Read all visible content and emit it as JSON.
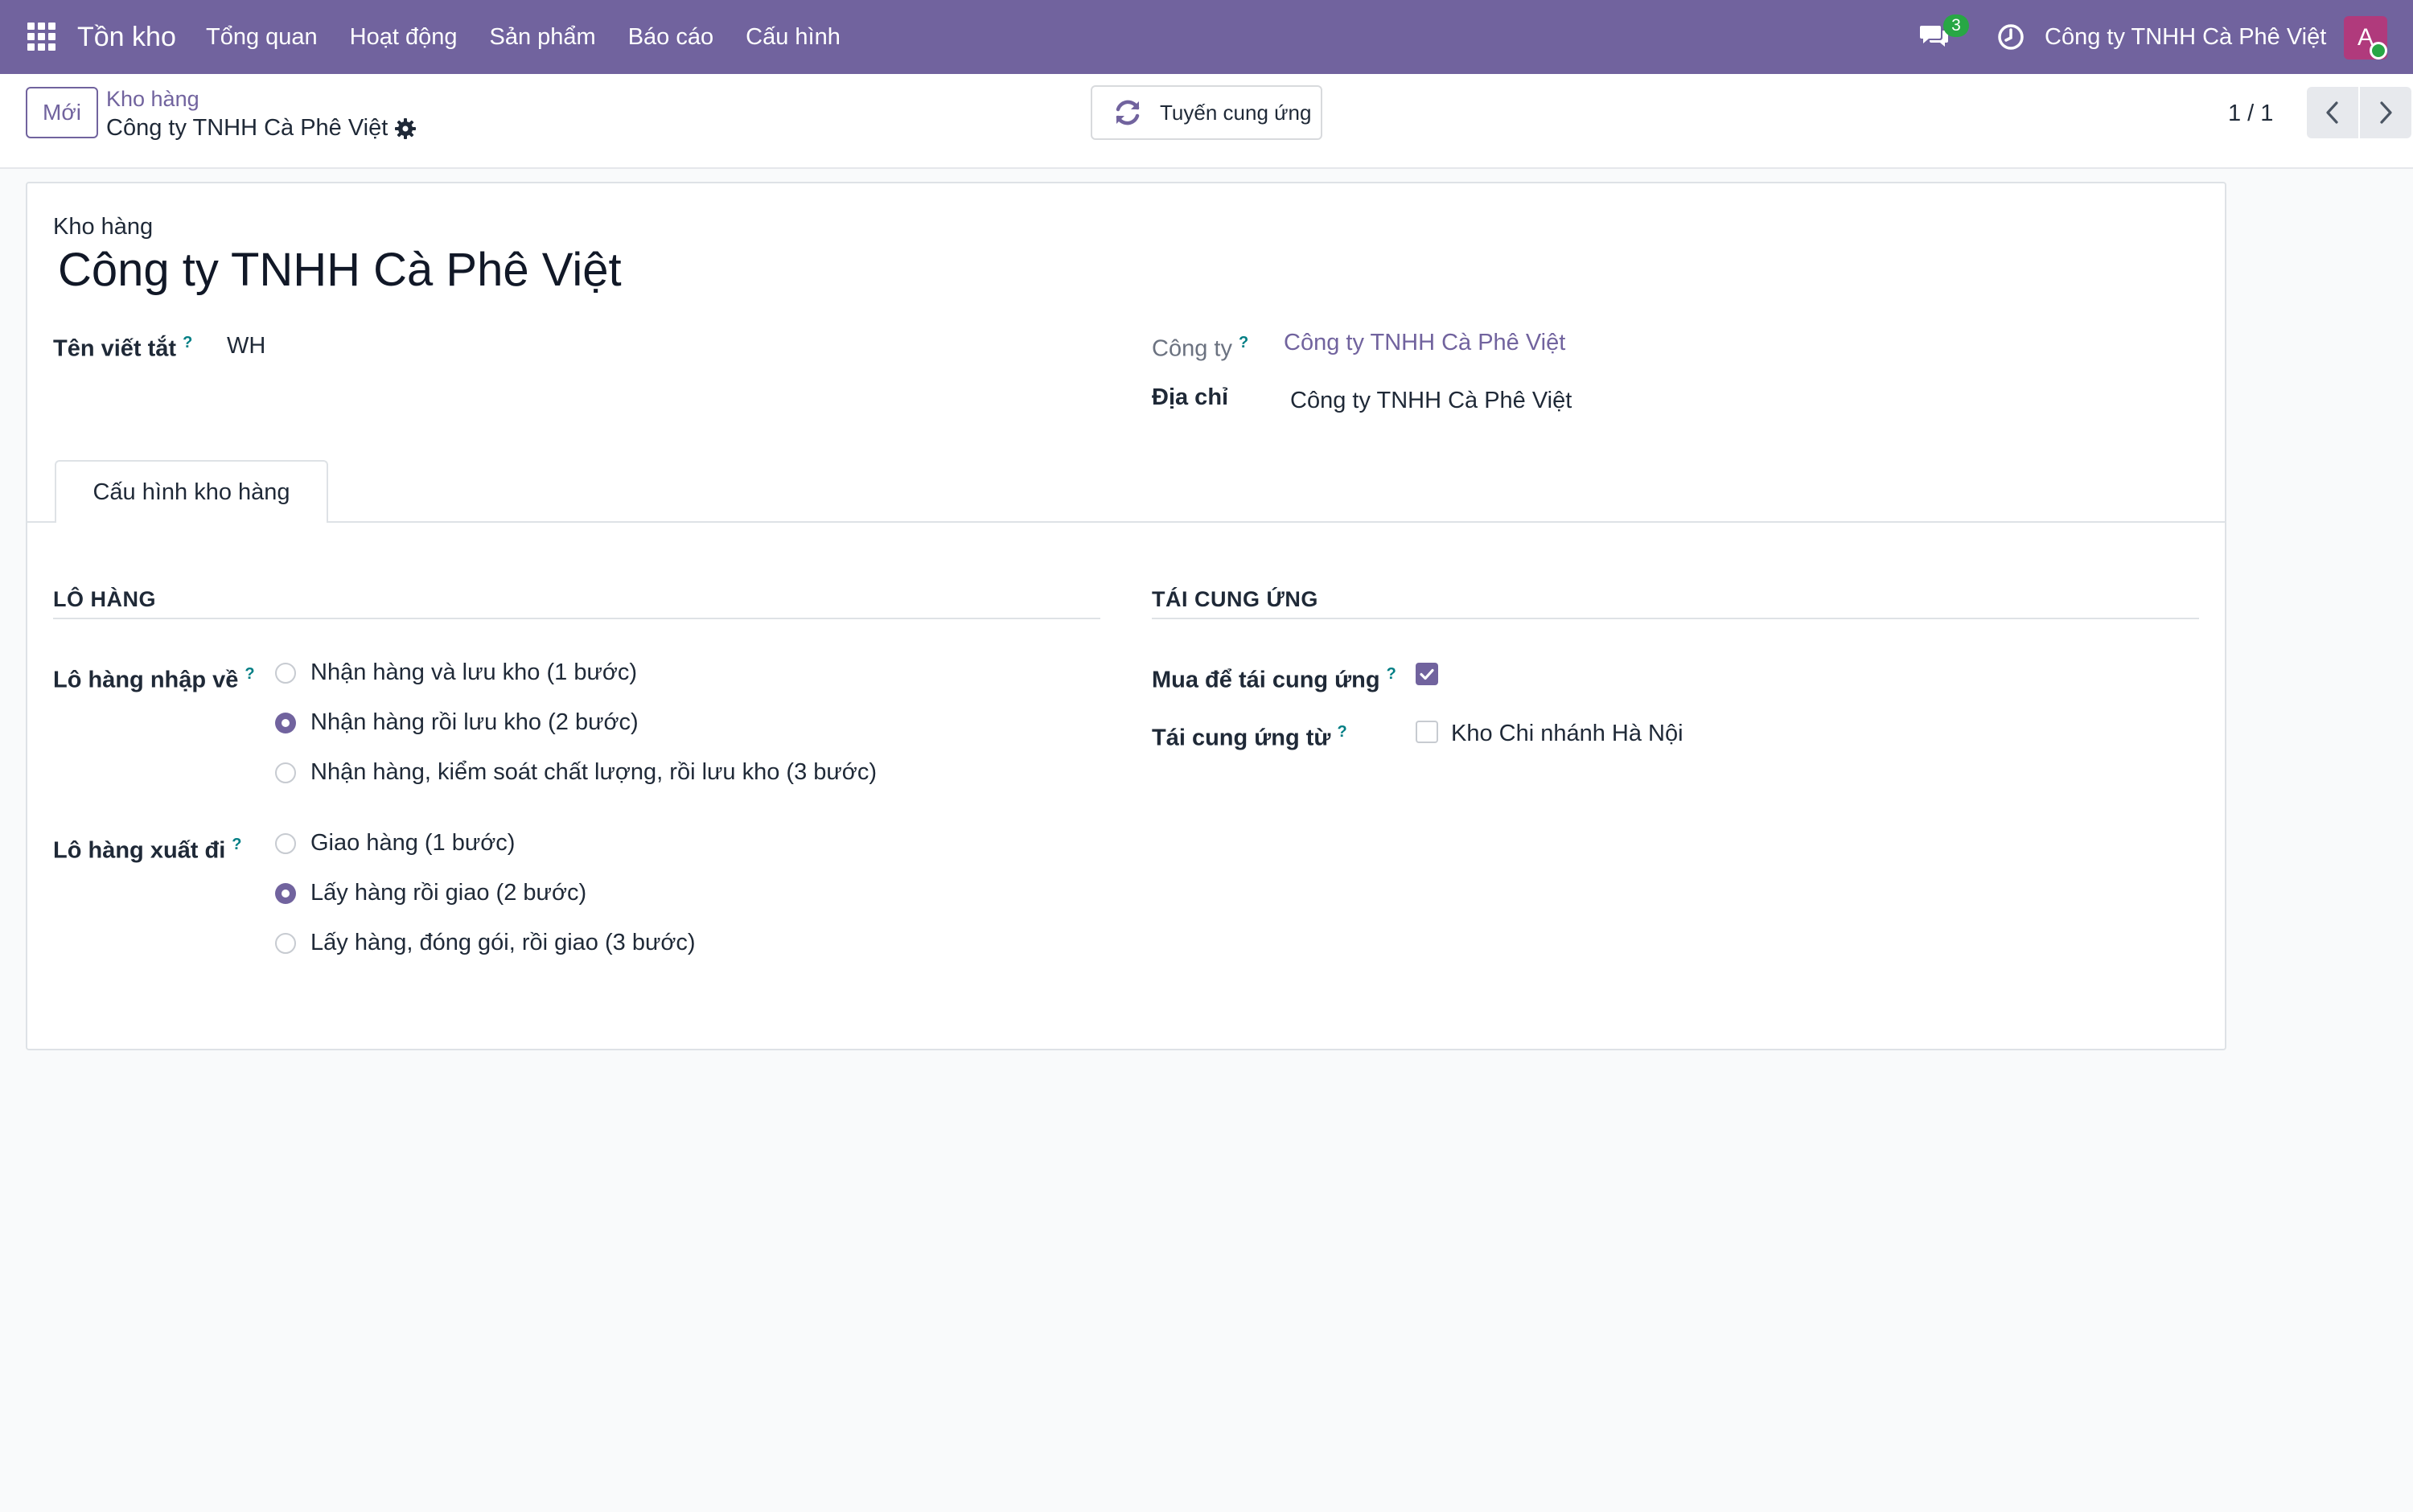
{
  "navbar": {
    "app_name": "Tồn kho",
    "menu": [
      "Tổng quan",
      "Hoạt động",
      "Sản phẩm",
      "Báo cáo",
      "Cấu hình"
    ],
    "messages_count": "3",
    "company": "Công ty TNHH Cà Phê Việt",
    "avatar_letter": "A",
    "icons": [
      "apps-grid-icon",
      "chat-icon",
      "clock-icon"
    ]
  },
  "control_panel": {
    "new_button": "Mới",
    "breadcrumb_parent": "Kho hàng",
    "breadcrumb_current": "Công ty TNHH Cà Phê Việt",
    "replenish_button": "Tuyến cung ứng",
    "pager": "1 / 1"
  },
  "form": {
    "title_label": "Kho hàng",
    "name": "Công ty TNHH Cà Phê Việt",
    "short_name_label": "Tên viết tắt",
    "short_name_value": "WH",
    "company_label": "Công ty",
    "company_value": "Công ty TNHH Cà Phê Việt",
    "address_label": "Địa chỉ",
    "address_value": "Công ty TNHH Cà Phê Việt",
    "help_mark": "?",
    "tab_label": "Cấu hình kho hàng",
    "shipments": {
      "title": "LÔ HÀNG",
      "incoming_label": "Lô hàng nhập về",
      "incoming_options": [
        {
          "label": "Nhận hàng và lưu kho (1 bước)",
          "selected": false
        },
        {
          "label": "Nhận hàng rồi lưu kho (2 bước)",
          "selected": true
        },
        {
          "label": "Nhận hàng, kiểm soát chất lượng, rồi lưu kho (3 bước)",
          "selected": false
        }
      ],
      "outgoing_label": "Lô hàng xuất đi",
      "outgoing_options": [
        {
          "label": "Giao hàng (1 bước)",
          "selected": false
        },
        {
          "label": "Lấy hàng rồi giao (2 bước)",
          "selected": true
        },
        {
          "label": "Lấy hàng, đóng gói, rồi giao (3 bước)",
          "selected": false
        }
      ]
    },
    "resupply": {
      "title": "TÁI CUNG ỨNG",
      "buy_label": "Mua để tái cung ứng",
      "buy_checked": true,
      "resupply_from_label": "Tái cung ứng từ",
      "resupply_from_option": "Kho Chi nhánh Hà Nội",
      "resupply_from_checked": false
    }
  },
  "colors": {
    "brand": "#71639e",
    "badge": "#28a745",
    "avatar": "#b03a7c",
    "help": "#017e84"
  }
}
